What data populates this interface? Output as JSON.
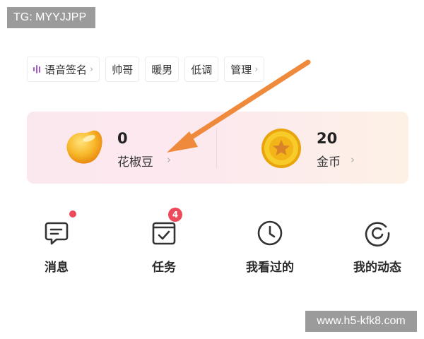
{
  "watermarks": {
    "top": "TG: MYYJJPP",
    "bottom": "www.h5-kfk8.com"
  },
  "tags": [
    {
      "label": "语音签名",
      "chevron": "›"
    },
    {
      "label": "帅哥"
    },
    {
      "label": "暖男"
    },
    {
      "label": "低调"
    },
    {
      "label": "管理",
      "chevron": "›"
    }
  ],
  "wallet": {
    "beans": {
      "value": "0",
      "label": "花椒豆",
      "chevron": "›"
    },
    "coins": {
      "value": "20",
      "label": "金币",
      "chevron": "›"
    }
  },
  "quick_menu": [
    {
      "label": "消息",
      "icon": "message-icon",
      "dot": true
    },
    {
      "label": "任务",
      "icon": "task-icon",
      "badge": "4"
    },
    {
      "label": "我看过的",
      "icon": "clock-icon"
    },
    {
      "label": "我的动态",
      "icon": "refresh-icon"
    }
  ],
  "colors": {
    "accent_red": "#ec4a5a",
    "arrow_orange": "#ef8a3c",
    "voice_purple": "#a35ac8",
    "coin_gold": "#f3c21a"
  }
}
